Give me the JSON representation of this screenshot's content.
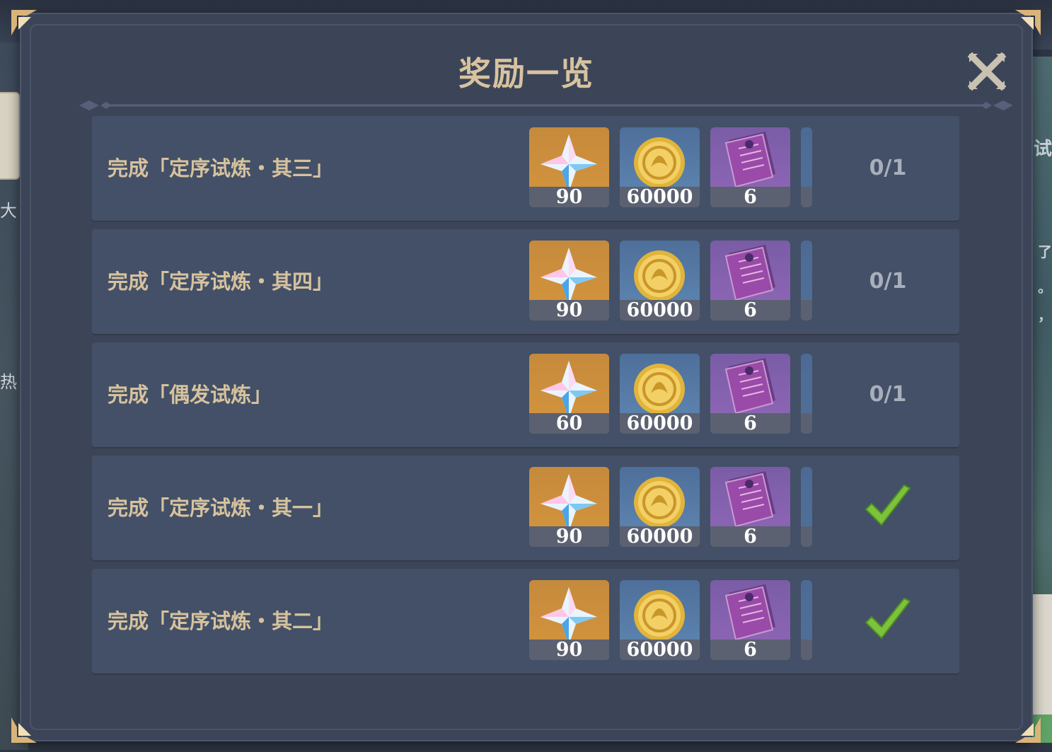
{
  "dialog": {
    "title": "奖励一览",
    "close_icon": "close-x-icon"
  },
  "rewards": [
    {
      "label": "完成「定序试炼・其三」",
      "items": [
        {
          "icon": "primogem-icon",
          "count": "90"
        },
        {
          "icon": "mora-coin-icon",
          "count": "60000"
        },
        {
          "icon": "purple-book-icon",
          "count": "6"
        }
      ],
      "status": "0/1",
      "completed": false
    },
    {
      "label": "完成「定序试炼・其四」",
      "items": [
        {
          "icon": "primogem-icon",
          "count": "90"
        },
        {
          "icon": "mora-coin-icon",
          "count": "60000"
        },
        {
          "icon": "purple-book-icon",
          "count": "6"
        }
      ],
      "status": "0/1",
      "completed": false
    },
    {
      "label": "完成「偶发试炼」",
      "items": [
        {
          "icon": "primogem-icon",
          "count": "60"
        },
        {
          "icon": "mora-coin-icon",
          "count": "60000"
        },
        {
          "icon": "purple-book-icon",
          "count": "6"
        }
      ],
      "status": "0/1",
      "completed": false
    },
    {
      "label": "完成「定序试炼・其一」",
      "items": [
        {
          "icon": "primogem-icon",
          "count": "90"
        },
        {
          "icon": "mora-coin-icon",
          "count": "60000"
        },
        {
          "icon": "purple-book-icon",
          "count": "6"
        }
      ],
      "status": "",
      "completed": true
    },
    {
      "label": "完成「定序试炼・其二」",
      "items": [
        {
          "icon": "primogem-icon",
          "count": "90"
        },
        {
          "icon": "mora-coin-icon",
          "count": "60000"
        },
        {
          "icon": "purple-book-icon",
          "count": "6"
        }
      ],
      "status": "",
      "completed": true
    }
  ],
  "background": {
    "left_chars": [
      "大",
      "热"
    ],
    "right_chars": [
      "试",
      "了",
      "。",
      "，"
    ]
  },
  "colors": {
    "panel": "#3c4558",
    "row": "#435067",
    "title": "#d8c39f",
    "label": "#d6c29d",
    "check": "#7cc23a"
  }
}
